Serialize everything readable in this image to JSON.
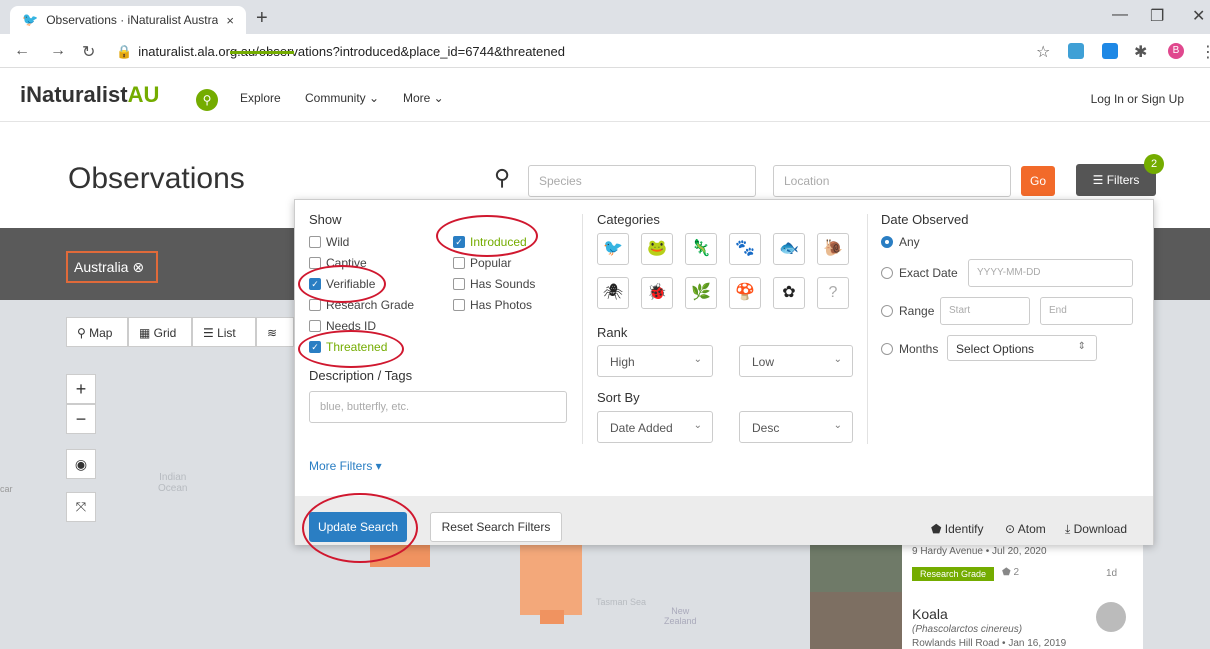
{
  "browser": {
    "tab_title": "Observations · iNaturalist Austral",
    "tab_close": "×",
    "new_tab": "+",
    "url": "inaturalist.ala.org.au/observations?introduced&place_id=6744&threatened",
    "profile_initial": "B"
  },
  "site": {
    "logo_main": "iNaturalist",
    "logo_suffix": "AU",
    "nav_explore": "Explore",
    "nav_community": "Community ⌄",
    "nav_more": "More ⌄",
    "login": "Log In or Sign Up"
  },
  "page": {
    "title": "Observations",
    "species_placeholder": "Species",
    "location_placeholder": "Location",
    "go_label": "Go",
    "filters_label": "Filters",
    "filters_count": "2",
    "place_pill": "Australia"
  },
  "views": {
    "map": "Map",
    "grid": "Grid",
    "list": "List"
  },
  "map": {
    "ocean_label_1": "Indian",
    "ocean_label_2": "Ocean",
    "tasman_label": "Tasman Sea",
    "nz_label_1": "New",
    "nz_label_2": "Zealand",
    "left_label": "car"
  },
  "filters": {
    "show_header": "Show",
    "show_left": [
      {
        "label": "Wild",
        "checked": false
      },
      {
        "label": "Captive",
        "checked": false
      },
      {
        "label": "Verifiable",
        "checked": true
      },
      {
        "label": "Research Grade",
        "checked": false
      },
      {
        "label": "Needs ID",
        "checked": false
      },
      {
        "label": "Threatened",
        "checked": true
      }
    ],
    "show_right": [
      {
        "label": "Introduced",
        "checked": true
      },
      {
        "label": "Popular",
        "checked": false
      },
      {
        "label": "Has Sounds",
        "checked": false
      },
      {
        "label": "Has Photos",
        "checked": false
      }
    ],
    "description_header": "Description / Tags",
    "description_placeholder": "blue, butterfly, etc.",
    "more_filters": "More Filters ▾",
    "categories_header": "Categories",
    "rank_header": "Rank",
    "rank_high": "High",
    "rank_low": "Low",
    "sort_header": "Sort By",
    "sort_field": "Date Added",
    "sort_order": "Desc",
    "date_header": "Date Observed",
    "date_any": "Any",
    "date_exact": "Exact Date",
    "date_exact_placeholder": "YYYY-MM-DD",
    "date_range": "Range",
    "date_start": "Start",
    "date_end": "End",
    "date_months": "Months",
    "months_select": "Select Options",
    "update_button": "Update Search",
    "reset_button": "Reset Search Filters",
    "identify": "Identify",
    "atom": "Atom",
    "download": "Download"
  },
  "cards": [
    {
      "place": "9 Hardy Avenue • Jul 20, 2020",
      "badge": "Research Grade",
      "ids": "2",
      "age": "1d"
    },
    {
      "name": "Koala",
      "sci": "(Phascolarctos cinereus)",
      "place": "Rowlands Hill Road • Jan 16, 2019"
    }
  ],
  "colors": {
    "inat_green": "#74ac00",
    "accent_blue": "#2a7ec3",
    "go_orange": "#f26a2a",
    "annotation_red": "#d0182f"
  }
}
